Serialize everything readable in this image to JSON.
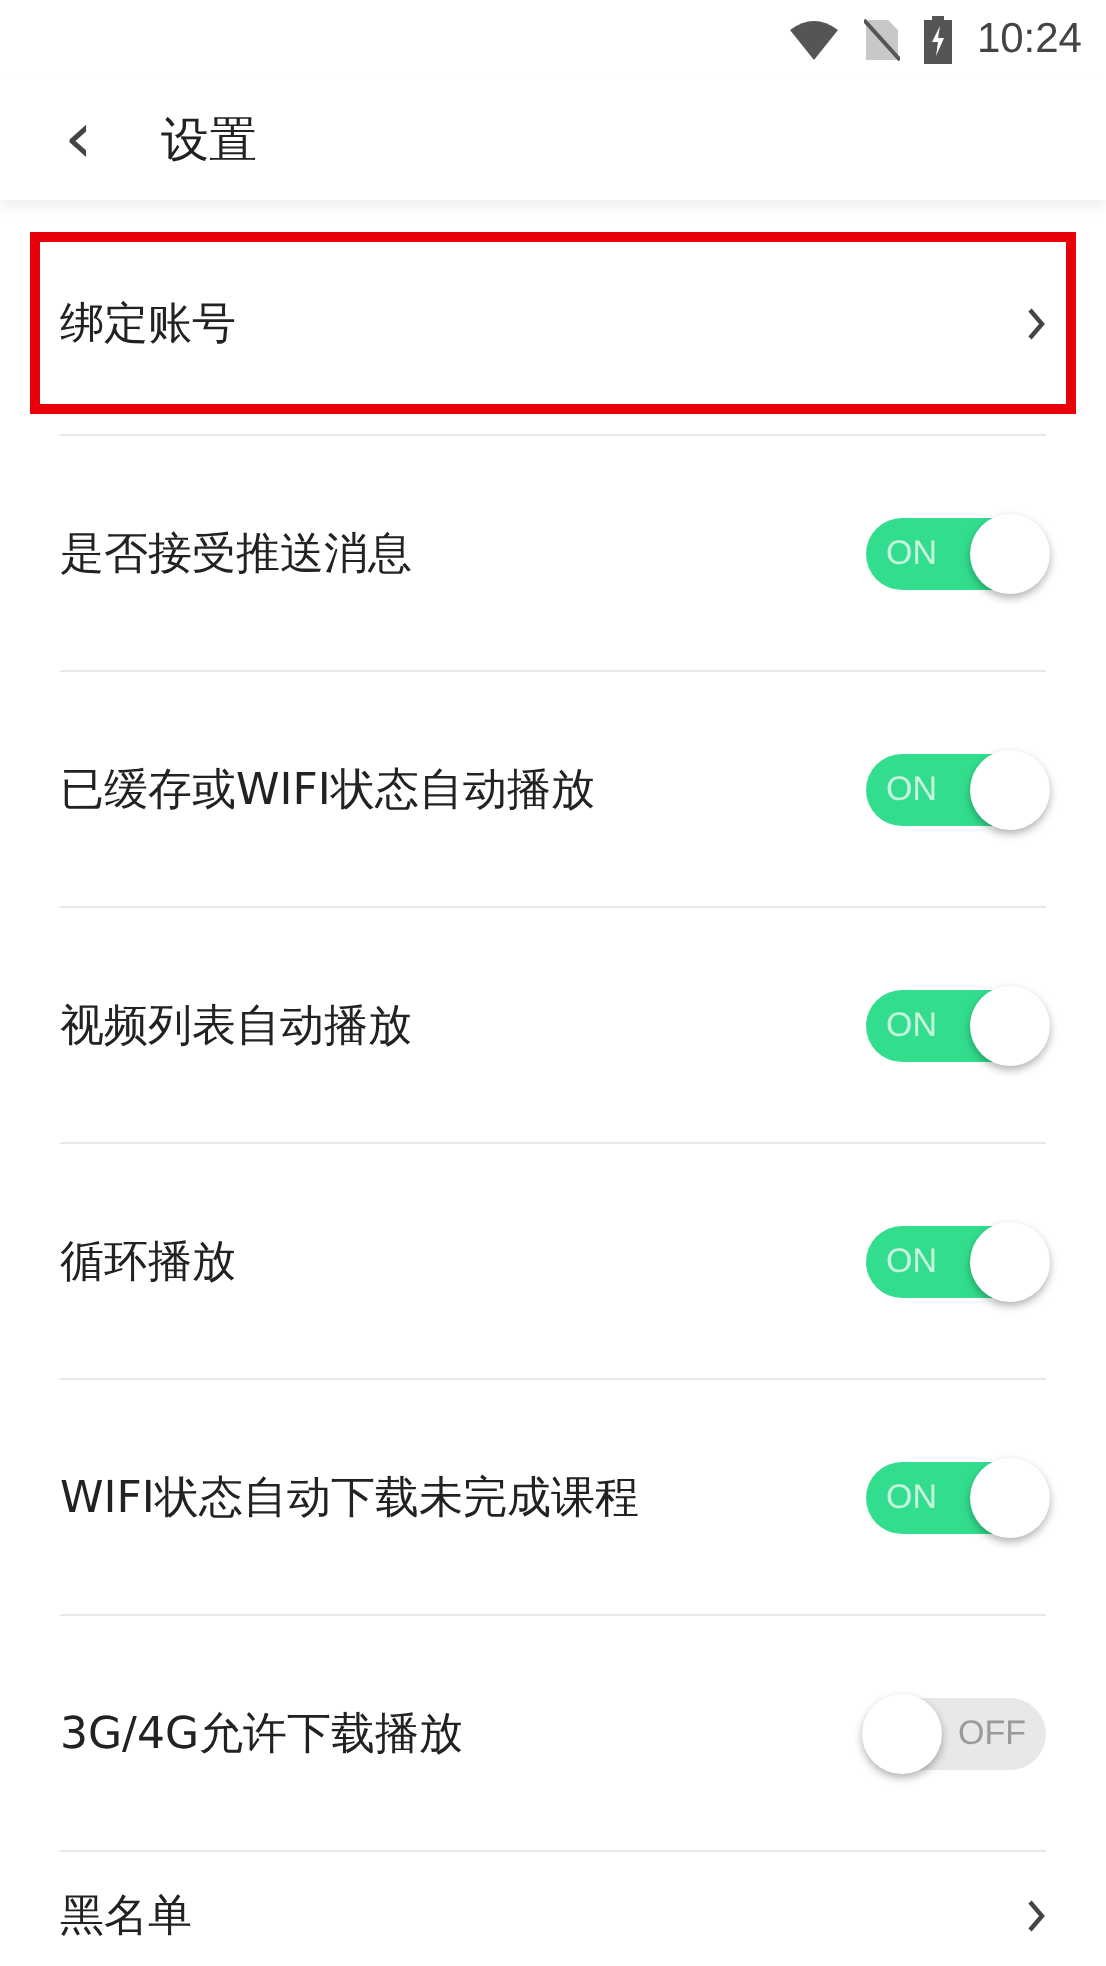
{
  "status_bar": {
    "time": "10:24"
  },
  "header": {
    "back": "‹",
    "title": "设置"
  },
  "settings": [
    {
      "kind": "link",
      "label": "绑定账号",
      "highlighted": true
    },
    {
      "kind": "toggle",
      "label": "是否接受推送消息",
      "on": true,
      "state_text": "ON"
    },
    {
      "kind": "toggle",
      "label": "已缓存或WIFI状态自动播放",
      "on": true,
      "state_text": "ON"
    },
    {
      "kind": "toggle",
      "label": "视频列表自动播放",
      "on": true,
      "state_text": "ON"
    },
    {
      "kind": "toggle",
      "label": "循环播放",
      "on": true,
      "state_text": "ON"
    },
    {
      "kind": "toggle",
      "label": "WIFI状态自动下载未完成课程",
      "on": true,
      "state_text": "ON"
    },
    {
      "kind": "toggle",
      "label": "3G/4G允许下载播放",
      "on": false,
      "state_text": "OFF"
    },
    {
      "kind": "link",
      "label": "黑名单",
      "highlighted": false
    }
  ]
}
